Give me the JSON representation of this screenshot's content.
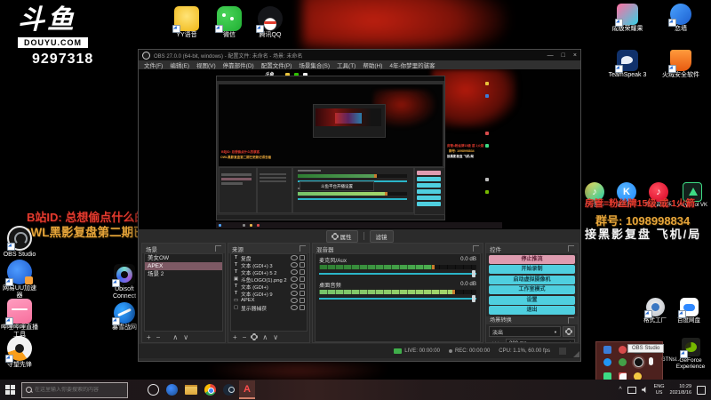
{
  "desktop": {
    "douyu": {
      "logo_text": "斗鱼",
      "logo_sub": "DOUYU.COM",
      "room_id": "9297318"
    },
    "top_icons": [
      {
        "label": "YY语音"
      },
      {
        "label": "微信"
      },
      {
        "label": "腾讯QQ"
      }
    ],
    "top_right_icons": [
      {
        "label": "成版荣耀果"
      },
      {
        "label": "恋墙"
      },
      {
        "label": "TeamSpeak 3"
      },
      {
        "label": "火绒安全软件"
      }
    ],
    "left_column_icons": [
      {
        "label": "OBS Studio"
      },
      {
        "label": "网易UU加速",
        "label2": "器"
      },
      {
        "label": "哔哩哔哩直播",
        "label2": "工具"
      },
      {
        "label": "守望先锋"
      }
    ],
    "second_column_icons": [
      {
        "label": "Ubisoft",
        "label2": "Connect"
      },
      {
        "label": "暴雪战网"
      }
    ],
    "right_column_icons": [
      {
        "label": "格式工厂"
      },
      {
        "label": "百度网盘"
      },
      {
        "label": "GTNsl..."
      },
      {
        "label": "GeForce",
        "label2": "Experience"
      }
    ],
    "overlay_left": {
      "line1": "B站ID: 总想偷点什么的骇客",
      "line2": "OWL黑影复盘第二期已更新记得去看"
    },
    "overlay_right": {
      "music_icons": [
        {
          "label": "QQ音乐"
        },
        {
          "label": "酷狗音乐"
        },
        {
          "label": "网易云音乐"
        },
        {
          "label": "VeryCool VK"
        }
      ],
      "line1": "房管=粉丝牌15级 或 1火箭",
      "line2": "群号: 1098998834",
      "line3": "接黑影复盘 飞机/局"
    }
  },
  "obs": {
    "title": "OBS 27.0.0 (64-bit, windows) - 配置文件: 未命名 - 场景: 未命名",
    "menu": [
      "文件(F)",
      "编辑(E)",
      "视图(V)",
      "停靠部件(D)",
      "配置文件(P)",
      "场景集合(S)",
      "工具(T)",
      "帮助(H)",
      "4年-你梦里的骇客"
    ],
    "source_toolbar": {
      "properties": "属性",
      "filters": "滤镜"
    },
    "docks": {
      "scenes": {
        "title": "场景",
        "items": [
          {
            "name": "美女OW",
            "selected": false
          },
          {
            "name": "APEX",
            "selected": true
          },
          {
            "name": "场景 2",
            "selected": false
          }
        ]
      },
      "sources": {
        "title": "来源",
        "items": [
          {
            "type": "text",
            "name": "复盘"
          },
          {
            "type": "text",
            "name": "文本 (GDI+) 3"
          },
          {
            "type": "text",
            "name": "文本 (GDI+) 5 2"
          },
          {
            "type": "image",
            "name": "斗鱼LOGO(1).png 2"
          },
          {
            "type": "text",
            "name": "文本 (GDI+)"
          },
          {
            "type": "text",
            "name": "文本 (GDI+) 9"
          },
          {
            "type": "game",
            "name": "APEX"
          },
          {
            "type": "display",
            "name": "显示器捕获"
          }
        ]
      },
      "mixer": {
        "title": "混音器",
        "channels": [
          {
            "name": "麦克风/Aux",
            "db": "0.0 dB",
            "level": 0.72
          },
          {
            "name": "桌面音频",
            "db": "0.0 dB",
            "level": 0.85
          }
        ]
      },
      "controls": {
        "title": "控件",
        "buttons": [
          {
            "label": "停止推流"
          },
          {
            "label": "开始录制"
          },
          {
            "label": "启动虚拟摄像机"
          },
          {
            "label": "工作室模式"
          },
          {
            "label": "设置"
          },
          {
            "label": "退出"
          }
        ]
      },
      "transitions": {
        "title": "场景转换",
        "value": "淡出",
        "duration_label": "时长",
        "duration": "300 ms"
      }
    },
    "status": {
      "live": "LIVE: 00:00:00",
      "rec": "REC: 00:00:00",
      "cpu": "CPU: 1.1%, 60.00 fps"
    },
    "preview": {
      "dialog_title": "斗鱼平台开播设置"
    }
  },
  "tray_popup": {
    "tooltip": "OBS Studio"
  },
  "taskbar": {
    "search_placeholder": "在这里输入你要搜索的内容",
    "tray": {
      "lang_line1": "ENG",
      "lang_line2": "US",
      "time": "10:29",
      "date": "2021/8/16"
    }
  },
  "colors": {
    "accent_cyan": "#4fcfdf",
    "accent_pink": "#df9cb0",
    "meter_green": "#4caf50",
    "slider_cyan": "#2ab5c9",
    "overlay_red": "#e23b2e",
    "overlay_yellow": "#e6a53a",
    "wallpaper_red": "#8a1408"
  }
}
